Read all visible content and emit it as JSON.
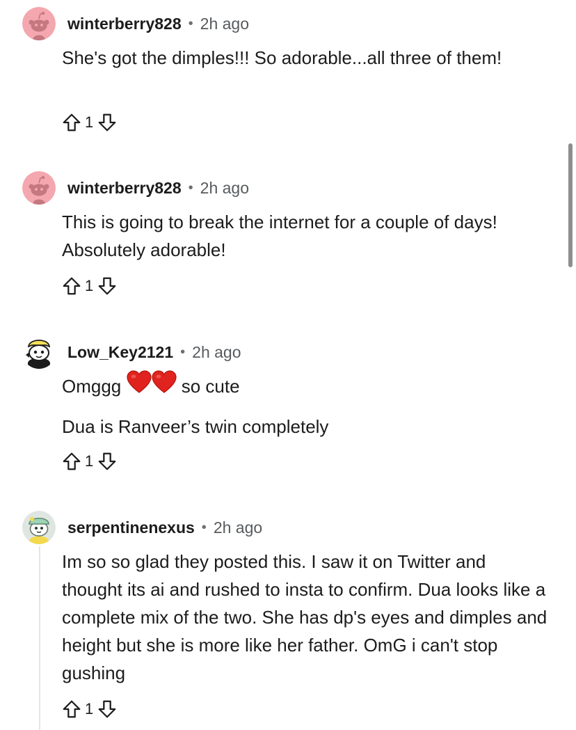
{
  "colors": {
    "text": "#1c1c1c",
    "meta": "#575b5e",
    "snoo_avatar_bg": "#f4a7ae",
    "heart": "#e0231e"
  },
  "comments": [
    {
      "username": "winterberry828",
      "separator": "•",
      "time": "2h ago",
      "avatar_icon": "snoo-avatar-pink-icon",
      "paragraphs": [
        "She's got the dimples!!! So adorable...all three of them!"
      ],
      "score": "1"
    },
    {
      "username": "winterberry828",
      "separator": "•",
      "time": "2h ago",
      "avatar_icon": "snoo-avatar-pink-icon",
      "paragraphs": [
        "This is going to break the internet for a couple of days! Absolutely adorable!"
      ],
      "score": "1"
    },
    {
      "username": "Low_Key2121",
      "separator": "•",
      "time": "2h ago",
      "avatar_icon": "snoo-avatar-yellow-hat-icon",
      "line1_before": "Omggg",
      "line1_emoji": "red-heart-icon",
      "line1_after": "so cute",
      "line2": "Dua is Ranveer’s twin completely",
      "score": "1"
    },
    {
      "username": "serpentinenexus",
      "separator": "•",
      "time": "2h ago",
      "avatar_icon": "snoo-avatar-green-hat-icon",
      "paragraphs": [
        "Im so so glad they posted this. I saw it on Twitter and thought its ai and rushed to insta to confirm. Dua looks like a complete mix of the two. She has dp's eyes and dimples and height but she is more like her father. OmG i can't stop gushing"
      ],
      "score": "1"
    }
  ]
}
